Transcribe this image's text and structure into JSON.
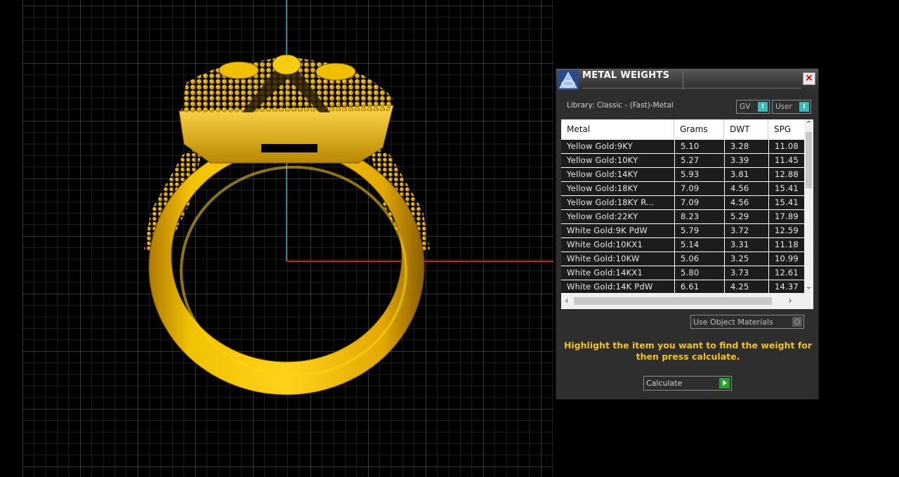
{
  "panel": {
    "title": "METAL WEIGHTS",
    "library_label": "Library: Classic - (Fast)-Metal",
    "toggles": [
      {
        "label": "GV",
        "indicator": "I"
      },
      {
        "label": "User",
        "indicator": "I"
      }
    ],
    "columns": [
      "Metal",
      "Grams",
      "DWT",
      "SPG"
    ],
    "rows": [
      {
        "metal": "Yellow Gold:9KY",
        "grams": "5.10",
        "dwt": "3.28",
        "spg": "11.08"
      },
      {
        "metal": "Yellow Gold:10KY",
        "grams": "5.27",
        "dwt": "3.39",
        "spg": "11.45"
      },
      {
        "metal": "Yellow Gold:14KY",
        "grams": "5.93",
        "dwt": "3.81",
        "spg": "12.88"
      },
      {
        "metal": "Yellow Gold:18KY",
        "grams": "7.09",
        "dwt": "4.56",
        "spg": "15.41"
      },
      {
        "metal": "Yellow Gold:18KY R...",
        "grams": "7.09",
        "dwt": "4.56",
        "spg": "15.41"
      },
      {
        "metal": "Yellow Gold:22KY",
        "grams": "8.23",
        "dwt": "5.29",
        "spg": "17.89"
      },
      {
        "metal": "White Gold:9K PdW",
        "grams": "5.79",
        "dwt": "3.72",
        "spg": "12.59"
      },
      {
        "metal": "White Gold:10KX1",
        "grams": "5.14",
        "dwt": "3.31",
        "spg": "11.18"
      },
      {
        "metal": "White Gold:10KW",
        "grams": "5.06",
        "dwt": "3.25",
        "spg": "10.99"
      },
      {
        "metal": "White Gold:14KX1",
        "grams": "5.80",
        "dwt": "3.73",
        "spg": "12.61"
      },
      {
        "metal": "White Gold:14K PdW",
        "grams": "6.61",
        "dwt": "4.25",
        "spg": "14.37"
      }
    ],
    "use_object_materials_label": "Use Object Materials",
    "instruction": "Highlight the item you want to find the weight for then press calculate.",
    "calculate_label": "Calculate",
    "colors": {
      "instruction_text": "#f0c419",
      "toggle_indicator": "#3bb8b8",
      "calculate_go": "#26a326",
      "ring_gold": "#e0a800"
    }
  }
}
